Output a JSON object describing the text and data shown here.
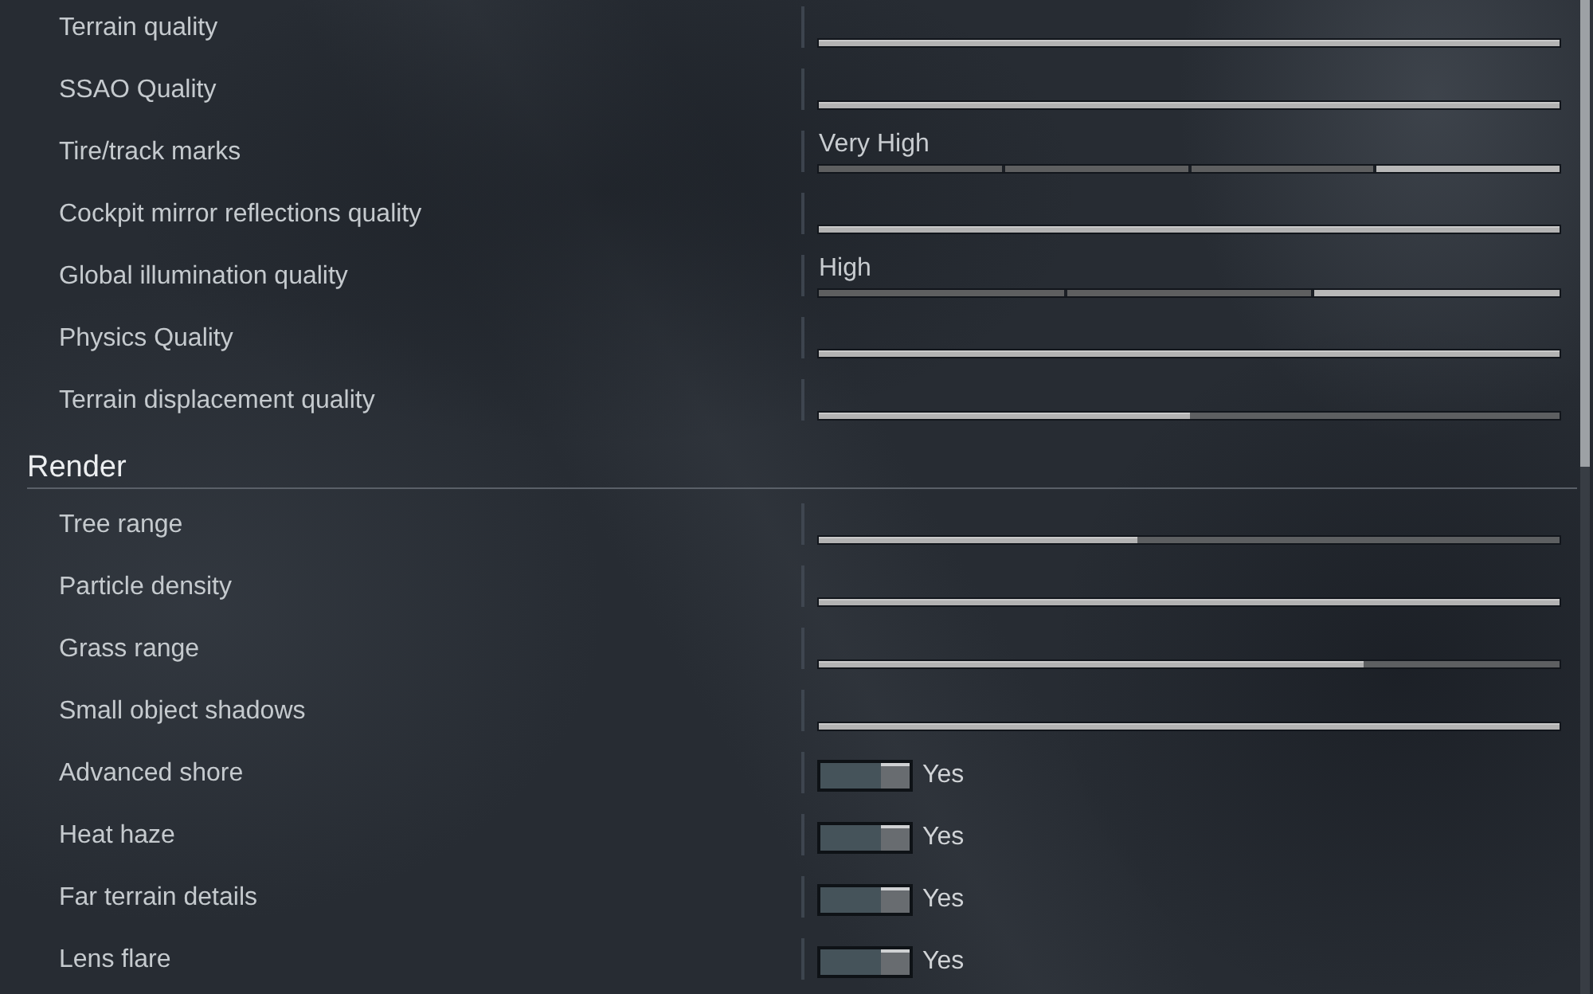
{
  "sections": [
    {
      "settings": [
        {
          "label": "Terrain quality",
          "kind": "slider",
          "level": 1
        },
        {
          "label": "SSAO Quality",
          "kind": "slider",
          "level": 1
        },
        {
          "label": "Tire/track marks",
          "kind": "steps",
          "reading": "Very High",
          "steps": [
            {
              "selected": false
            },
            {
              "selected": false
            },
            {
              "selected": false
            },
            {
              "selected": true
            }
          ]
        },
        {
          "label": "Cockpit mirror reflections quality",
          "kind": "slider",
          "level": 1
        },
        {
          "label": "Global illumination quality",
          "kind": "steps",
          "reading": "High",
          "steps": [
            {
              "selected": false
            },
            {
              "selected": false
            },
            {
              "selected": true
            }
          ]
        },
        {
          "label": "Physics Quality",
          "kind": "slider",
          "level": 1
        },
        {
          "label": "Terrain displacement quality",
          "kind": "slider",
          "level": 0.5
        }
      ]
    },
    {
      "title": "Render",
      "settings": [
        {
          "label": "Tree range",
          "kind": "slider",
          "level": 0.43
        },
        {
          "label": "Particle density",
          "kind": "slider",
          "level": 1
        },
        {
          "label": "Grass range",
          "kind": "slider",
          "level": 0.735
        },
        {
          "label": "Small object shadows",
          "kind": "slider",
          "level": 1
        },
        {
          "label": "Advanced shore",
          "kind": "toggle",
          "on": true,
          "value": "Yes"
        },
        {
          "label": "Heat haze",
          "kind": "toggle",
          "on": true,
          "value": "Yes"
        },
        {
          "label": "Far terrain details",
          "kind": "toggle",
          "on": true,
          "value": "Yes"
        },
        {
          "label": "Lens flare",
          "kind": "toggle",
          "on": true,
          "value": "Yes"
        }
      ]
    }
  ]
}
